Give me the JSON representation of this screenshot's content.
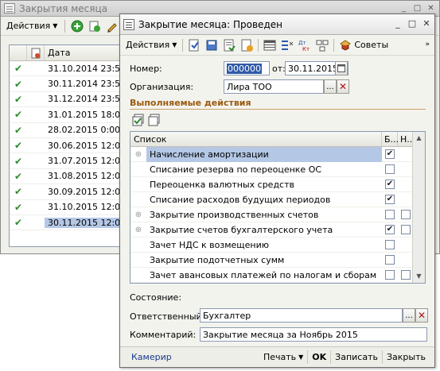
{
  "background_window": {
    "title": "Закрытия месяца",
    "toolbar": {
      "actions_label": "Действия"
    },
    "table": {
      "date_header": "Дата",
      "rows": [
        {
          "date": "31.10.2014 23:59:5",
          "selected": false
        },
        {
          "date": "30.11.2014 23:59:5",
          "selected": false
        },
        {
          "date": "31.12.2014 23:59:5",
          "selected": false
        },
        {
          "date": "31.01.2015 18:09:2",
          "selected": false
        },
        {
          "date": "28.02.2015 0:00:02",
          "selected": false
        },
        {
          "date": "30.06.2015 12:00:0",
          "selected": false
        },
        {
          "date": "31.07.2015 12:00:0",
          "selected": false
        },
        {
          "date": "31.08.2015 12:00:0",
          "selected": false
        },
        {
          "date": "30.09.2015 12:00:0",
          "selected": false
        },
        {
          "date": "31.10.2015 12:00:0",
          "selected": false
        },
        {
          "date": "30.11.2015 12:00:0",
          "selected": true
        }
      ]
    }
  },
  "dialog": {
    "title": "Закрытие месяца: Проведен",
    "toolbar": {
      "actions_label": "Действия",
      "advice_label": "Советы"
    },
    "form": {
      "number_label": "Номер:",
      "number_value": "000000",
      "from_label": "от:",
      "date_value": "30.11.2015 12:0",
      "org_label": "Организация:",
      "org_value": "Лира ТОО"
    },
    "section_title": "Выполняемые действия",
    "grid": {
      "headers": {
        "list": "Список",
        "b": "Б...",
        "n": "Н..."
      },
      "rows": [
        {
          "name": "Начисление амортизации",
          "expandable": true,
          "b": true,
          "n": null,
          "selected": true
        },
        {
          "name": "Списание резерва по переоценке ОС",
          "expandable": false,
          "b": false,
          "n": null,
          "selected": false
        },
        {
          "name": "Переоценка валютных средств",
          "expandable": false,
          "b": true,
          "n": null,
          "selected": false
        },
        {
          "name": "Списание расходов будущих периодов",
          "expandable": false,
          "b": true,
          "n": null,
          "selected": false
        },
        {
          "name": "Закрытие производственных счетов",
          "expandable": true,
          "b": false,
          "n": false,
          "selected": false
        },
        {
          "name": "Закрытие счетов бухгалтерского учета",
          "expandable": true,
          "b": true,
          "n": false,
          "selected": false
        },
        {
          "name": "Зачет НДС к возмещению",
          "expandable": false,
          "b": false,
          "n": null,
          "selected": false
        },
        {
          "name": "Закрытие подотчетных сумм",
          "expandable": false,
          "b": false,
          "n": null,
          "selected": false
        },
        {
          "name": "Зачет авансовых платежей по налогам и сборам",
          "expandable": false,
          "b": false,
          "n": false,
          "selected": false
        }
      ]
    },
    "state_label": "Состояние:",
    "responsible_label": "Ответственный:",
    "responsible_value": "Бухгалтер",
    "comment_label": "Комментарий:",
    "comment_value": "Закрытие месяца за Ноябрь 2015",
    "bottom": {
      "link": "Камерир",
      "print_label": "Печать",
      "ok_label": "OK",
      "save_label": "Записать",
      "close_label": "Закрыть"
    }
  },
  "colors": {
    "check_green": "#2f8a2f",
    "selection": "#b4c8e6",
    "section_title": "#9a5a10",
    "link": "#1a3a8a"
  }
}
